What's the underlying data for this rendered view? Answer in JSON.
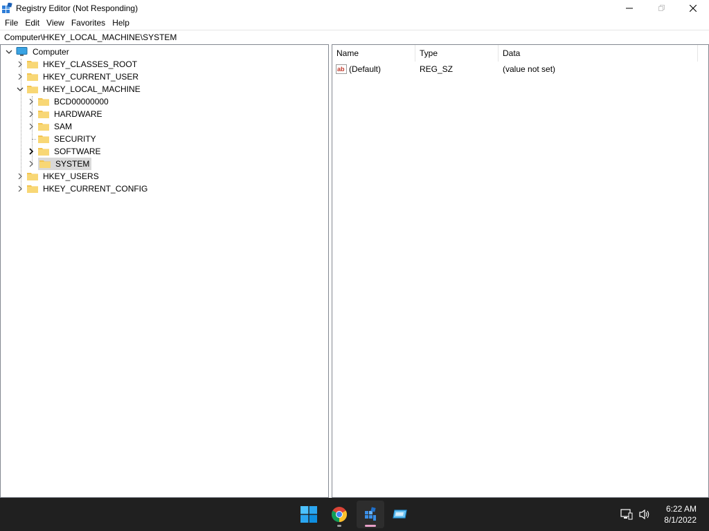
{
  "window": {
    "title": "Registry Editor (Not Responding)",
    "icon": "regedit-icon",
    "controls": {
      "minimize": "minimize-icon",
      "maximize": "maximize-icon",
      "close": "close-icon"
    }
  },
  "menu": {
    "items": [
      {
        "label": "File"
      },
      {
        "label": "Edit"
      },
      {
        "label": "View"
      },
      {
        "label": "Favorites"
      },
      {
        "label": "Help"
      }
    ]
  },
  "address": {
    "path": "Computer\\HKEY_LOCAL_MACHINE\\SYSTEM"
  },
  "tree": {
    "root": {
      "label": "Computer",
      "expanded": true
    },
    "hives": [
      {
        "label": "HKEY_CLASSES_ROOT",
        "expanded": false
      },
      {
        "label": "HKEY_CURRENT_USER",
        "expanded": false
      },
      {
        "label": "HKEY_LOCAL_MACHINE",
        "expanded": true
      },
      {
        "label": "HKEY_USERS",
        "expanded": false
      },
      {
        "label": "HKEY_CURRENT_CONFIG",
        "expanded": false
      }
    ],
    "hklm_children": [
      {
        "label": "BCD00000000",
        "has_children": true
      },
      {
        "label": "HARDWARE",
        "has_children": true
      },
      {
        "label": "SAM",
        "has_children": true
      },
      {
        "label": "SECURITY",
        "has_children": false
      },
      {
        "label": "SOFTWARE",
        "has_children": true
      },
      {
        "label": "SYSTEM",
        "has_children": true,
        "selected": true
      }
    ]
  },
  "list": {
    "columns": {
      "name": "Name",
      "type": "Type",
      "data": "Data"
    },
    "rows": [
      {
        "name": "(Default)",
        "type": "REG_SZ",
        "data": "(value not set)",
        "icon": "string-value-icon"
      }
    ]
  },
  "taskbar": {
    "apps": [
      {
        "name": "start-button",
        "icon": "windows-logo-icon"
      },
      {
        "name": "chrome",
        "icon": "chrome-icon"
      },
      {
        "name": "registry-editor",
        "icon": "regedit-icon",
        "active": true
      },
      {
        "name": "remote-desktop",
        "icon": "remote-desktop-icon"
      }
    ],
    "tray": {
      "network": "network-icon",
      "volume": "volume-icon"
    },
    "clock": {
      "time": "6:22 AM",
      "date": "8/1/2022"
    }
  },
  "colors": {
    "accent": "#0078d4",
    "selection": "#d9d9d9",
    "folder": "#f8d775",
    "taskbar": "#202020",
    "indicator_active": "#e8a0c8"
  }
}
